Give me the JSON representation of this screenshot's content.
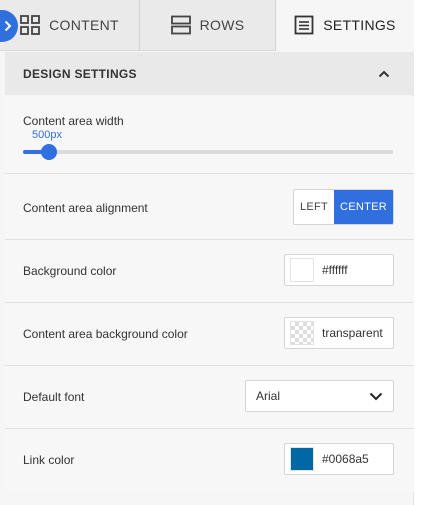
{
  "tabs": [
    {
      "label": "CONTENT",
      "icon": "grid-icon"
    },
    {
      "label": "ROWS",
      "icon": "rows-icon"
    },
    {
      "label": "SETTINGS",
      "icon": "settings-list-icon",
      "active": true
    }
  ],
  "section": {
    "title": "DESIGN SETTINGS",
    "expanded": true
  },
  "settings": {
    "content_width": {
      "label": "Content area width",
      "value_text": "500px",
      "slider_fraction": 0.07
    },
    "alignment": {
      "label": "Content area alignment",
      "options": [
        "LEFT",
        "CENTER"
      ],
      "selected": "CENTER"
    },
    "background_color": {
      "label": "Background color",
      "value": "#ffffff",
      "swatch": "#ffffff"
    },
    "content_bg_color": {
      "label": "Content area background color",
      "value": "transparent"
    },
    "default_font": {
      "label": "Default font",
      "value": "Arial"
    },
    "link_color": {
      "label": "Link color",
      "value": "#0068a5",
      "swatch": "#0068a5"
    }
  },
  "colors": {
    "accent": "#2f6fde"
  }
}
